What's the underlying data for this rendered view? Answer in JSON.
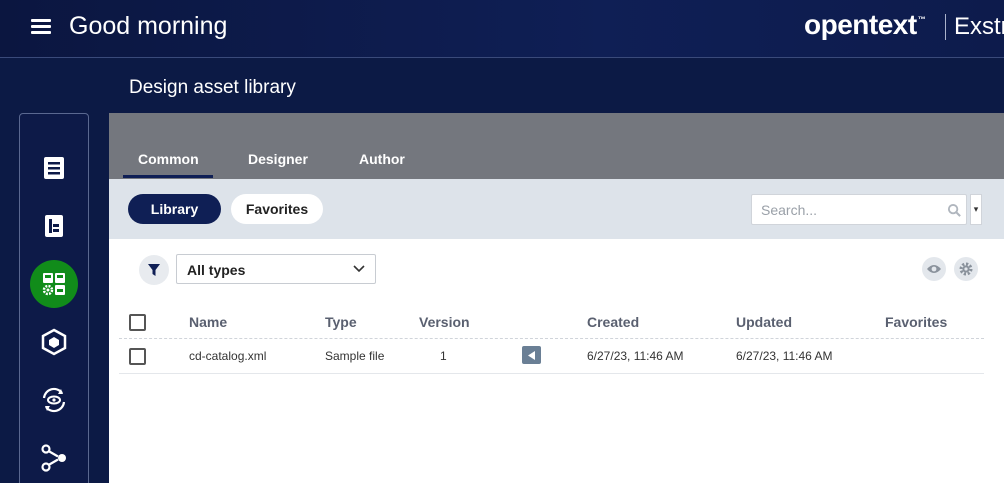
{
  "header": {
    "greeting": "Good morning",
    "brand": "opentext",
    "brand_tm": "™",
    "product": "Exstr"
  },
  "page": {
    "title": "Design asset library"
  },
  "rail": {
    "items": [
      {
        "name": "list-icon",
        "active": false
      },
      {
        "name": "document-tree-icon",
        "active": false
      },
      {
        "name": "dashboard-settings-icon",
        "active": true
      },
      {
        "name": "cube-icon",
        "active": false
      },
      {
        "name": "eye-cycle-icon",
        "active": false
      },
      {
        "name": "workflow-icon",
        "active": false
      }
    ]
  },
  "tabs": [
    {
      "label": "Common",
      "active": true
    },
    {
      "label": "Designer",
      "active": false
    },
    {
      "label": "Author",
      "active": false
    }
  ],
  "toolbar": {
    "library_label": "Library",
    "favorites_label": "Favorites",
    "search_placeholder": "Search...",
    "search_dropdown": "▾"
  },
  "filter": {
    "type_value": "All types"
  },
  "table": {
    "columns": [
      "Name",
      "Type",
      "Version",
      "Created",
      "Updated",
      "Favorites"
    ],
    "rows": [
      {
        "name": "cd-catalog.xml",
        "type": "Sample file",
        "version": "1",
        "created": "6/27/23, 11:46 AM",
        "updated": "6/27/23, 11:46 AM",
        "favorites": ""
      }
    ]
  },
  "colors": {
    "navy": "#0f1f55",
    "active_green": "#118c1a",
    "tab_bar": "#74777e",
    "toolbar_bg": "#dde3ea"
  }
}
